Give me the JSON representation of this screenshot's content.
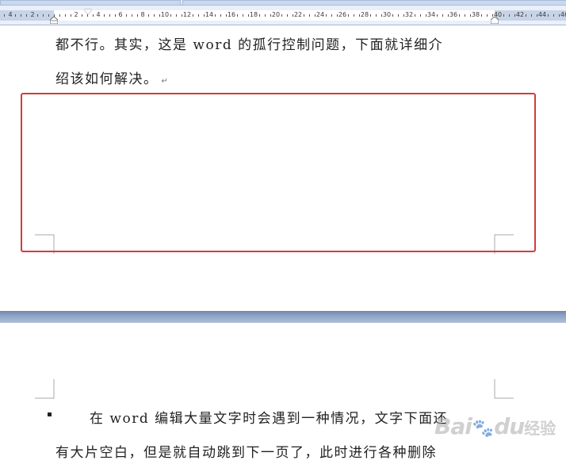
{
  "ruler": {
    "numbers": [
      "4",
      "2",
      "2",
      "4",
      "6",
      "8",
      "10",
      "12",
      "14",
      "16",
      "18",
      "20",
      "22",
      "24",
      "26",
      "28",
      "30",
      "32",
      "34",
      "36",
      "38",
      "40",
      "42",
      "44",
      "46"
    ]
  },
  "document": {
    "page1": {
      "line1": "都不行。其实，这是 word 的孤行控制问题，下面就详细介",
      "line2": "绍该如何解决。",
      "paragraph_mark": "↵"
    },
    "page2": {
      "line1": "在 word 编辑大量文字时会遇到一种情况，文字下面还",
      "line2": "有大片空白，但是就自动跳到下一页了，此时进行各种删除"
    }
  },
  "highlight": {
    "color": "#d43c3c"
  },
  "watermark": {
    "brand": "Bai",
    "suffix": "du",
    "product": "经验"
  }
}
